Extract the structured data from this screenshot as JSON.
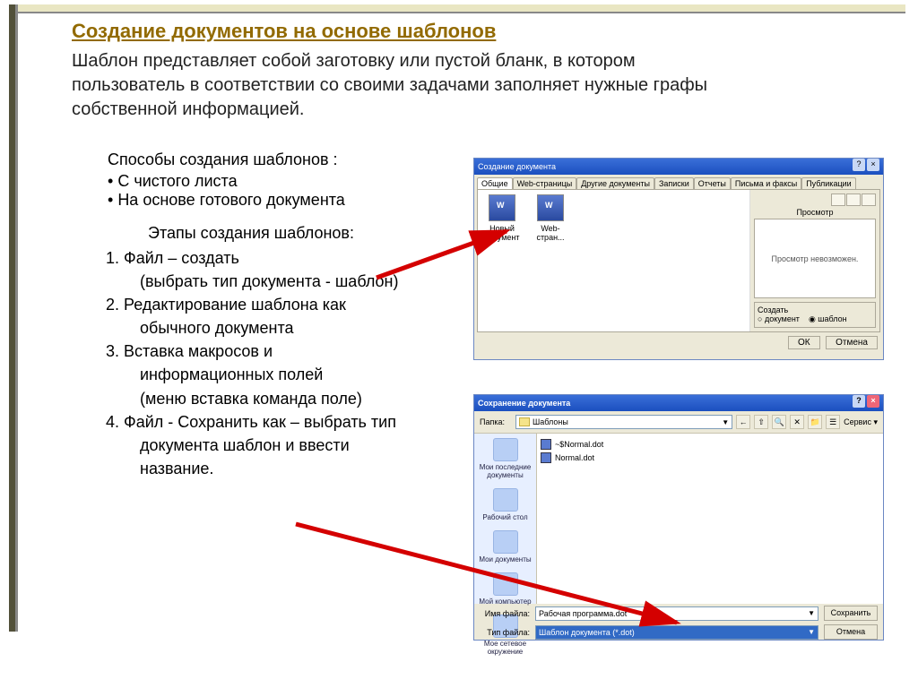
{
  "title": "Создание документов на основе шаблонов",
  "description": "Шаблон представляет собой заготовку или пустой бланк, в котором пользователь в соответствии со своими задачами заполняет нужные графы собственной информацией.",
  "ways_title": "Способы создания шаблонов :",
  "ways": [
    "С чистого листа",
    "На основе готового документа"
  ],
  "steps_title": "Этапы создания шаблонов:",
  "steps": {
    "s1": "1. Файл – создать",
    "s1a": "(выбрать тип документа - шаблон)",
    "s2": "2. Редактирование шаблона как",
    "s2a": "обычного документа",
    "s3": "3. Вставка макросов и",
    "s3a": "информационных полей",
    "s3b": "(меню вставка команда поле)",
    "s4": "4. Файл - Сохранить как – выбрать тип",
    "s4a": "документа шаблон и ввести",
    "s4b": "название."
  },
  "dlg1": {
    "title": "Создание документа",
    "tabs": [
      "Общие",
      "Web-страницы",
      "Другие документы",
      "Записки",
      "Отчеты",
      "Письма и факсы",
      "Публикации"
    ],
    "icons": [
      {
        "label": "Новый документ"
      },
      {
        "label": "Web-стран..."
      }
    ],
    "preview_label": "Просмотр",
    "preview_text": "Просмотр невозможен.",
    "create_group": "Создать",
    "radio_doc": "документ",
    "radio_tpl": "шаблон",
    "ok": "ОК",
    "cancel": "Отмена"
  },
  "dlg2": {
    "title": "Сохранение документа",
    "folder_label": "Папка:",
    "folder_value": "Шаблоны",
    "service": "Сервис",
    "places": [
      "Мои последние документы",
      "Рабочий стол",
      "Мои документы",
      "Мой компьютер",
      "Мое сетевое окружение"
    ],
    "files": [
      "~$Normal.dot",
      "Normal.dot"
    ],
    "filename_label": "Имя файла:",
    "filename_value": "Рабочая программа.dot",
    "filetype_label": "Тип файла:",
    "filetype_value": "Шаблон документа (*.dot)",
    "save": "Сохранить",
    "cancel": "Отмена"
  }
}
